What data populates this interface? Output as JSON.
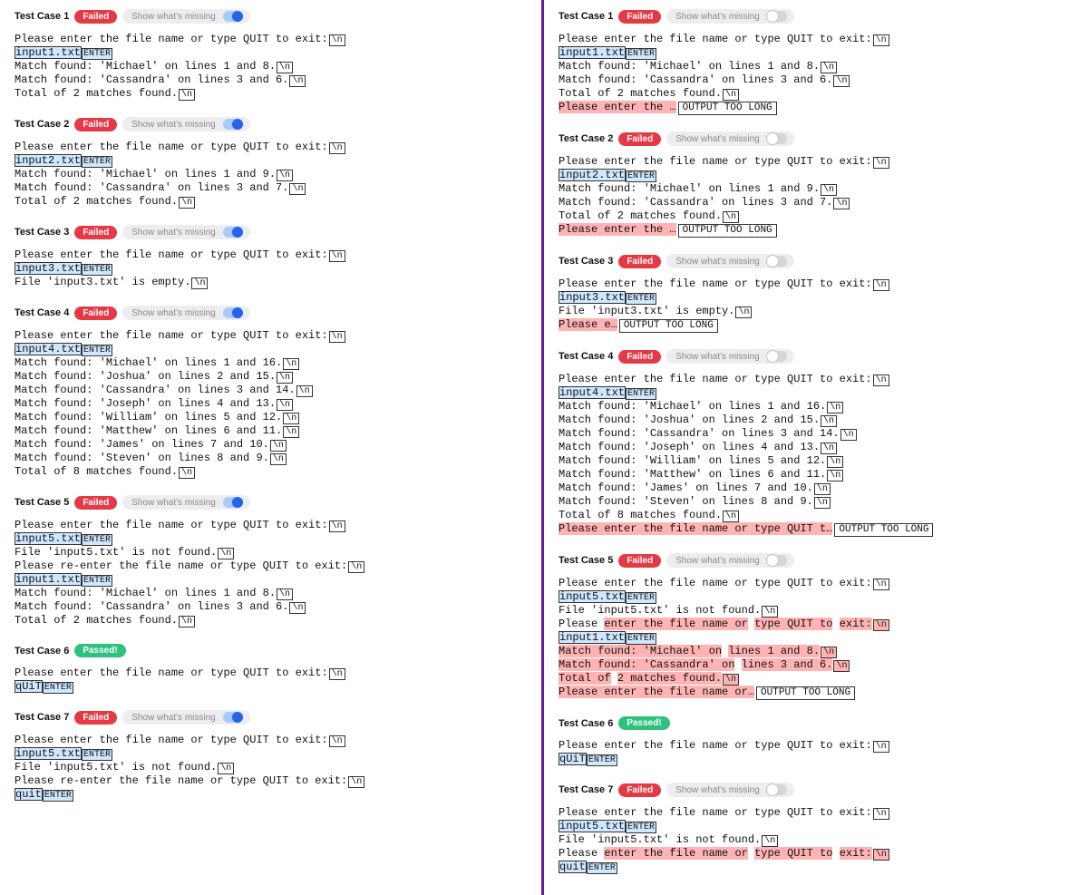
{
  "labels": {
    "show_missing": "Show what's missing",
    "failed": "Failed",
    "passed": "Passed!",
    "enter": "ENTER",
    "newline": "\\n",
    "output_too_long": "OUTPUT TOO LONG"
  },
  "left": {
    "toggle_on": true,
    "testcases": [
      {
        "title": "Test Case 1",
        "status": "failed",
        "show_toggle": true,
        "lines": [
          [
            {
              "t": "Please enter the file name or type QUIT to exit:"
            },
            {
              "nl": true
            }
          ],
          [
            {
              "t": "input1.txt",
              "hl": "in"
            },
            {
              "enter": true,
              "hl": "in"
            }
          ],
          [
            {
              "t": "Match found: 'Michael' on lines 1 and 8."
            },
            {
              "nl": true
            }
          ],
          [
            {
              "t": "Match found: 'Cassandra' on lines 3 and 6."
            },
            {
              "nl": true
            }
          ],
          [
            {
              "t": "Total of 2 matches found."
            },
            {
              "nl": true
            }
          ]
        ]
      },
      {
        "title": "Test Case 2",
        "status": "failed",
        "show_toggle": true,
        "lines": [
          [
            {
              "t": "Please enter the file name or type QUIT to exit:"
            },
            {
              "nl": true
            }
          ],
          [
            {
              "t": "input2.txt",
              "hl": "in"
            },
            {
              "enter": true,
              "hl": "in"
            }
          ],
          [
            {
              "t": "Match found: 'Michael' on lines 1 and 9."
            },
            {
              "nl": true
            }
          ],
          [
            {
              "t": "Match found: 'Cassandra' on lines 3 and 7."
            },
            {
              "nl": true
            }
          ],
          [
            {
              "t": "Total of 2 matches found."
            },
            {
              "nl": true
            }
          ]
        ]
      },
      {
        "title": "Test Case 3",
        "status": "failed",
        "show_toggle": true,
        "lines": [
          [
            {
              "t": "Please enter the file name or type QUIT to exit:"
            },
            {
              "nl": true
            }
          ],
          [
            {
              "t": "input3.txt",
              "hl": "in"
            },
            {
              "enter": true,
              "hl": "in"
            }
          ],
          [
            {
              "t": "File 'input3.txt' is empty."
            },
            {
              "nl": true
            }
          ]
        ]
      },
      {
        "title": "Test Case 4",
        "status": "failed",
        "show_toggle": true,
        "lines": [
          [
            {
              "t": "Please enter the file name or type QUIT to exit:"
            },
            {
              "nl": true
            }
          ],
          [
            {
              "t": "input4.txt",
              "hl": "in"
            },
            {
              "enter": true,
              "hl": "in"
            }
          ],
          [
            {
              "t": "Match found: 'Michael' on lines 1 and 16."
            },
            {
              "nl": true
            }
          ],
          [
            {
              "t": "Match found: 'Joshua' on lines 2 and 15."
            },
            {
              "nl": true
            }
          ],
          [
            {
              "t": "Match found: 'Cassandra' on lines 3 and 14."
            },
            {
              "nl": true
            }
          ],
          [
            {
              "t": "Match found: 'Joseph' on lines 4 and 13."
            },
            {
              "nl": true
            }
          ],
          [
            {
              "t": "Match found: 'William' on lines 5 and 12."
            },
            {
              "nl": true
            }
          ],
          [
            {
              "t": "Match found: 'Matthew' on lines 6 and 11."
            },
            {
              "nl": true
            }
          ],
          [
            {
              "t": "Match found: 'James' on lines 7 and 10."
            },
            {
              "nl": true
            }
          ],
          [
            {
              "t": "Match found: 'Steven' on lines 8 and 9."
            },
            {
              "nl": true
            }
          ],
          [
            {
              "t": "Total of 8 matches found."
            },
            {
              "nl": true
            }
          ]
        ]
      },
      {
        "title": "Test Case 5",
        "status": "failed",
        "show_toggle": true,
        "lines": [
          [
            {
              "t": "Please enter the file name or type QUIT to exit:"
            },
            {
              "nl": true
            }
          ],
          [
            {
              "t": "input5.txt",
              "hl": "in"
            },
            {
              "enter": true,
              "hl": "in"
            }
          ],
          [
            {
              "t": "File 'input5.txt' is not found."
            },
            {
              "nl": true
            }
          ],
          [
            {
              "t": "Please re-enter the file name or type QUIT to exit:"
            },
            {
              "nl": true
            }
          ],
          [
            {
              "t": "input1.txt",
              "hl": "in"
            },
            {
              "enter": true,
              "hl": "in"
            }
          ],
          [
            {
              "t": "Match found: 'Michael' on lines 1 and 8."
            },
            {
              "nl": true
            }
          ],
          [
            {
              "t": "Match found: 'Cassandra' on lines 3 and 6."
            },
            {
              "nl": true
            }
          ],
          [
            {
              "t": "Total of 2 matches found."
            },
            {
              "nl": true
            }
          ]
        ]
      },
      {
        "title": "Test Case 6",
        "status": "passed",
        "show_toggle": false,
        "lines": [
          [
            {
              "t": "Please enter the file name or type QUIT to exit:"
            },
            {
              "nl": true
            }
          ],
          [
            {
              "t": "qUiT",
              "hl": "in"
            },
            {
              "enter": true,
              "hl": "in"
            }
          ]
        ]
      },
      {
        "title": "Test Case 7",
        "status": "failed",
        "show_toggle": true,
        "lines": [
          [
            {
              "t": "Please enter the file name or type QUIT to exit:"
            },
            {
              "nl": true
            }
          ],
          [
            {
              "t": "input5.txt",
              "hl": "in"
            },
            {
              "enter": true,
              "hl": "in"
            }
          ],
          [
            {
              "t": "File 'input5.txt' is not found."
            },
            {
              "nl": true
            }
          ],
          [
            {
              "t": "Please re-enter the file name or type QUIT to exit:"
            },
            {
              "nl": true
            }
          ],
          [
            {
              "t": "quit",
              "hl": "in"
            },
            {
              "enter": true,
              "hl": "in"
            }
          ]
        ]
      }
    ]
  },
  "right": {
    "toggle_on": false,
    "testcases": [
      {
        "title": "Test Case 1",
        "status": "failed",
        "show_toggle": true,
        "lines": [
          [
            {
              "t": "Please enter the file name or type QUIT to exit:"
            },
            {
              "nl": true
            }
          ],
          [
            {
              "t": "input1.txt",
              "hl": "in"
            },
            {
              "enter": true,
              "hl": "in"
            }
          ],
          [
            {
              "t": "Match found: 'Michael' on lines 1 and 8."
            },
            {
              "nl": true
            }
          ],
          [
            {
              "t": "Match found: 'Cassandra' on lines 3 and 6."
            },
            {
              "nl": true
            }
          ],
          [
            {
              "t": "Total of 2 matches found."
            },
            {
              "nl": true
            }
          ],
          [
            {
              "t": "Please enter the …",
              "hl": "diff"
            },
            {
              "too_long": true
            }
          ]
        ]
      },
      {
        "title": "Test Case 2",
        "status": "failed",
        "show_toggle": true,
        "lines": [
          [
            {
              "t": "Please enter the file name or type QUIT to exit:"
            },
            {
              "nl": true
            }
          ],
          [
            {
              "t": "input2.txt",
              "hl": "in"
            },
            {
              "enter": true,
              "hl": "in"
            }
          ],
          [
            {
              "t": "Match found: 'Michael' on lines 1 and 9."
            },
            {
              "nl": true
            }
          ],
          [
            {
              "t": "Match found: 'Cassandra' on lines 3 and 7."
            },
            {
              "nl": true
            }
          ],
          [
            {
              "t": "Total of 2 matches found."
            },
            {
              "nl": true
            }
          ],
          [
            {
              "t": "Please enter the …",
              "hl": "diff"
            },
            {
              "too_long": true
            }
          ]
        ]
      },
      {
        "title": "Test Case 3",
        "status": "failed",
        "show_toggle": true,
        "lines": [
          [
            {
              "t": "Please enter the file name or type QUIT to exit:"
            },
            {
              "nl": true
            }
          ],
          [
            {
              "t": "input3.txt",
              "hl": "in"
            },
            {
              "enter": true,
              "hl": "in"
            }
          ],
          [
            {
              "t": "File 'input3.txt' is empty."
            },
            {
              "nl": true
            }
          ],
          [
            {
              "t": "Please e…",
              "hl": "diff"
            },
            {
              "too_long": true
            }
          ]
        ]
      },
      {
        "title": "Test Case 4",
        "status": "failed",
        "show_toggle": true,
        "lines": [
          [
            {
              "t": "Please enter the file name or type QUIT to exit:"
            },
            {
              "nl": true
            }
          ],
          [
            {
              "t": "input4.txt",
              "hl": "in"
            },
            {
              "enter": true,
              "hl": "in"
            }
          ],
          [
            {
              "t": "Match found: 'Michael' on lines 1 and 16."
            },
            {
              "nl": true
            }
          ],
          [
            {
              "t": "Match found: 'Joshua' on lines 2 and 15."
            },
            {
              "nl": true
            }
          ],
          [
            {
              "t": "Match found: 'Cassandra' on lines 3 and 14."
            },
            {
              "nl": true
            }
          ],
          [
            {
              "t": "Match found: 'Joseph' on lines 4 and 13."
            },
            {
              "nl": true
            }
          ],
          [
            {
              "t": "Match found: 'William' on lines 5 and 12."
            },
            {
              "nl": true
            }
          ],
          [
            {
              "t": "Match found: 'Matthew' on lines 6 and 11."
            },
            {
              "nl": true
            }
          ],
          [
            {
              "t": "Match found: 'James' on lines 7 and 10."
            },
            {
              "nl": true
            }
          ],
          [
            {
              "t": "Match found: 'Steven' on lines 8 and 9."
            },
            {
              "nl": true
            }
          ],
          [
            {
              "t": "Total of 8 matches found."
            },
            {
              "nl": true
            }
          ],
          [
            {
              "t": "Please enter the file name or type QUIT t…",
              "hl": "diff"
            },
            {
              "too_long": true
            }
          ]
        ]
      },
      {
        "title": "Test Case 5",
        "status": "failed",
        "show_toggle": true,
        "lines": [
          [
            {
              "t": "Please enter the file name or type QUIT to exit:"
            },
            {
              "nl": true
            }
          ],
          [
            {
              "t": "input5.txt",
              "hl": "in"
            },
            {
              "enter": true,
              "hl": "in"
            }
          ],
          [
            {
              "t": "File 'input5.txt' is not found."
            },
            {
              "nl": true
            }
          ],
          [
            {
              "t": "Please "
            },
            {
              "t": "enter the file name or",
              "hl": "diff"
            },
            {
              "t": " "
            },
            {
              "t": "type QUIT to",
              "hl": "diff"
            },
            {
              "t": " "
            },
            {
              "t": "exit:",
              "hl": "diff"
            },
            {
              "nl": true,
              "hl": "diff"
            }
          ],
          [
            {
              "t": "input1.txt",
              "hl": "in"
            },
            {
              "enter": true,
              "hl": "in"
            }
          ],
          [
            {
              "t": "Match found: 'Michael' on",
              "hl": "diff"
            },
            {
              "t": " "
            },
            {
              "t": "lines 1 and 8.",
              "hl": "diff"
            },
            {
              "nl": true,
              "hl": "diff"
            }
          ],
          [
            {
              "t": "Match found: 'Cassandra' on",
              "hl": "diff"
            },
            {
              "t": " "
            },
            {
              "t": "lines 3 and 6.",
              "hl": "diff"
            },
            {
              "nl": true,
              "hl": "diff"
            }
          ],
          [
            {
              "t": "Total of",
              "hl": "diff"
            },
            {
              "t": " "
            },
            {
              "t": "2 matches found.",
              "hl": "diff"
            },
            {
              "nl": true,
              "hl": "diff"
            }
          ],
          [
            {
              "t": "Please enter the file name or…",
              "hl": "diff"
            },
            {
              "too_long": true
            }
          ]
        ]
      },
      {
        "title": "Test Case 6",
        "status": "passed",
        "show_toggle": false,
        "lines": [
          [
            {
              "t": "Please enter the file name or type QUIT to exit:"
            },
            {
              "nl": true
            }
          ],
          [
            {
              "t": "qUiT",
              "hl": "in"
            },
            {
              "enter": true,
              "hl": "in"
            }
          ]
        ]
      },
      {
        "title": "Test Case 7",
        "status": "failed",
        "show_toggle": true,
        "lines": [
          [
            {
              "t": "Please enter the file name or type QUIT to exit:"
            },
            {
              "nl": true
            }
          ],
          [
            {
              "t": "input5.txt",
              "hl": "in"
            },
            {
              "enter": true,
              "hl": "in"
            }
          ],
          [
            {
              "t": "File 'input5.txt' is not found."
            },
            {
              "nl": true
            }
          ],
          [
            {
              "t": "Please "
            },
            {
              "t": "enter the file name or",
              "hl": "diff"
            },
            {
              "t": " "
            },
            {
              "t": "type QUIT to",
              "hl": "diff"
            },
            {
              "t": " "
            },
            {
              "t": "exit:",
              "hl": "diff"
            },
            {
              "nl": true,
              "hl": "diff"
            }
          ],
          [
            {
              "t": "quit",
              "hl": "in"
            },
            {
              "enter": true,
              "hl": "in"
            }
          ]
        ]
      }
    ]
  }
}
